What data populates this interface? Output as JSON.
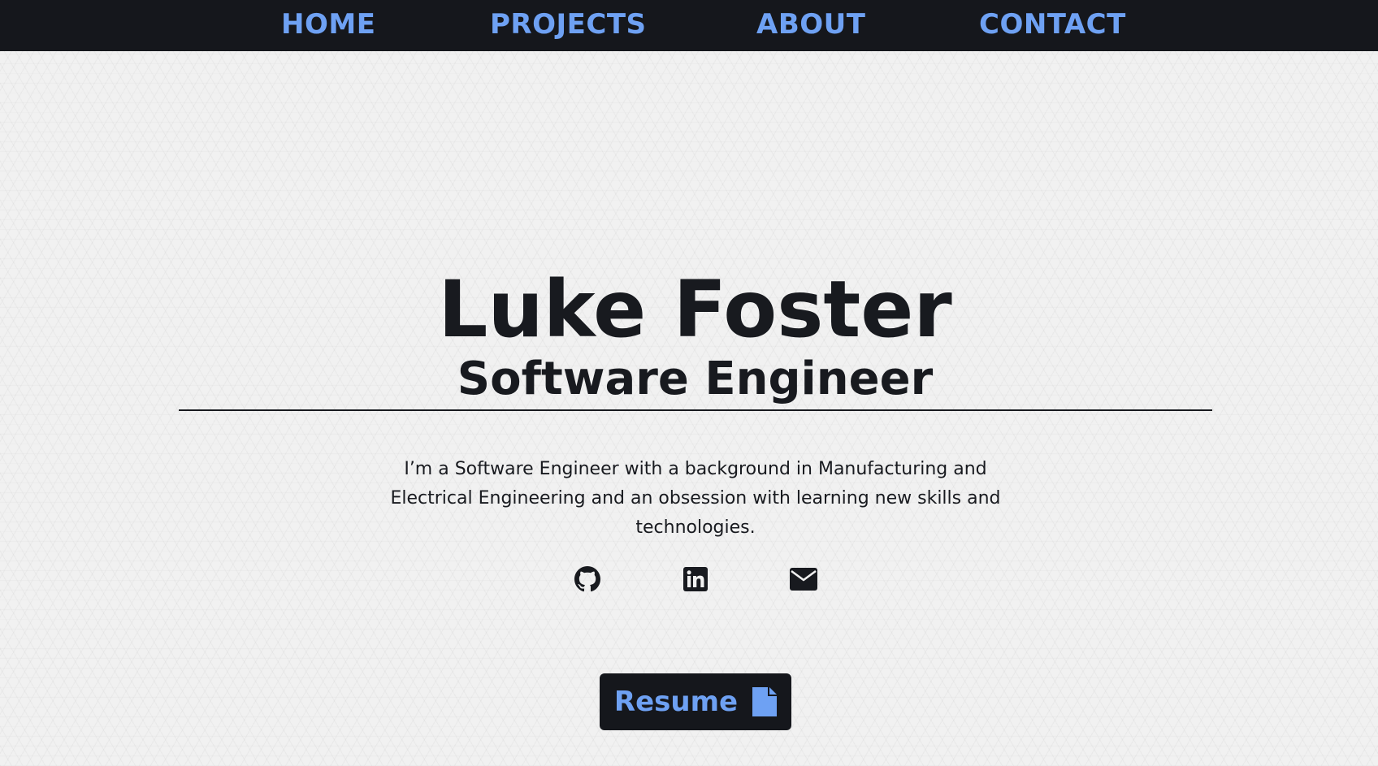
{
  "colors": {
    "nav_background": "#15171c",
    "nav_text": "#6ea1f3",
    "text": "#181a1f",
    "page_background": "#f1f1f1",
    "button_background": "#15171c",
    "button_text": "#6ea1f3"
  },
  "nav": {
    "items": [
      {
        "label": "HOME"
      },
      {
        "label": "PROJECTS"
      },
      {
        "label": "ABOUT"
      },
      {
        "label": "CONTACT"
      }
    ]
  },
  "hero": {
    "name": "Luke Foster",
    "title": "Software Engineer",
    "bio": "I’m a Software Engineer with a background in Manufacturing and Electrical Engineering and an obsession with learning new skills and technologies."
  },
  "social": {
    "icons": [
      "github-icon",
      "linkedin-icon",
      "envelope-icon"
    ]
  },
  "resume": {
    "label": "Resume",
    "icon": "file-icon"
  }
}
